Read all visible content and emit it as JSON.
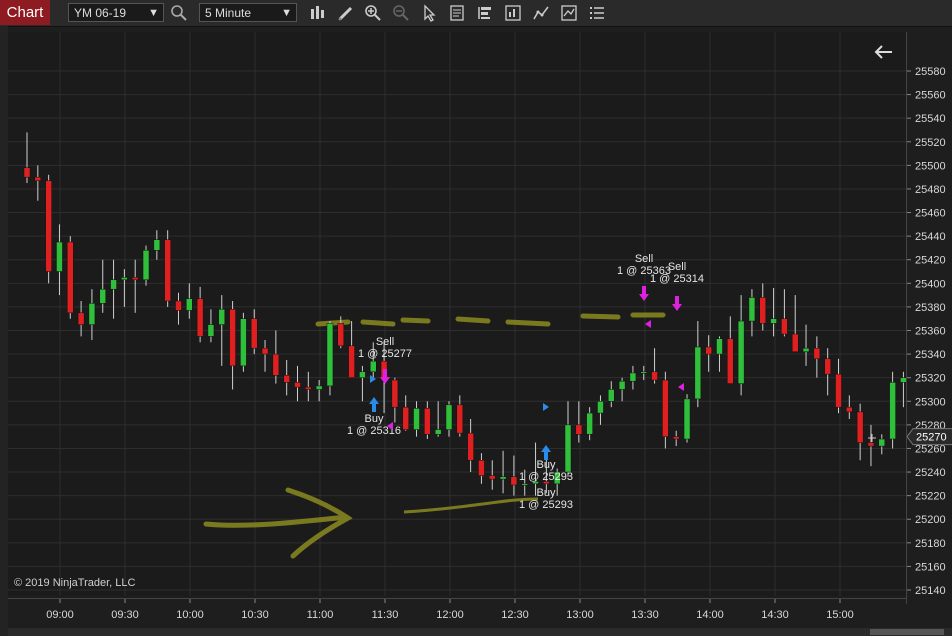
{
  "toolbar": {
    "tab_label": "Chart",
    "instrument": "YM 06-19",
    "interval": "5 Minute",
    "icons": [
      "search-icon",
      "bar-type-icon",
      "pencil-icon",
      "zoom-in-icon",
      "zoom-out-icon",
      "pointer-icon",
      "properties-icon",
      "strategies-icon",
      "indicators-icon",
      "drawing-tools-icon",
      "data-box-icon",
      "list-icon"
    ]
  },
  "copyright": "© 2019 NinjaTrader, LLC",
  "f_button": "F",
  "colors": {
    "up": "#2fbf3a",
    "down": "#e02020",
    "grid": "#2e2e2e",
    "buy": "#2b8be8",
    "sell": "#e020e0",
    "price_tag": "#2a2a2a",
    "highlighter": "#8b8a20"
  },
  "chart_data": {
    "type": "candlestick",
    "instrument": "YM 06-19",
    "interval": "5 Minute",
    "ylim": [
      25140,
      25600
    ],
    "y_ticks": [
      25580,
      25560,
      25540,
      25520,
      25500,
      25480,
      25460,
      25440,
      25420,
      25400,
      25380,
      25360,
      25340,
      25320,
      25300,
      25280,
      25260,
      25240,
      25220,
      25200,
      25180,
      25160,
      25140
    ],
    "x_ticks": [
      "09:00",
      "09:30",
      "10:00",
      "10:30",
      "11:00",
      "11:30",
      "12:00",
      "12:30",
      "13:00",
      "13:30",
      "14:00",
      "14:30",
      "15:00"
    ],
    "last_price": "25270",
    "candles": [
      [
        25498,
        25528,
        25485,
        25490
      ],
      [
        25490,
        25500,
        25470,
        25487
      ],
      [
        25487,
        25492,
        25400,
        25410
      ],
      [
        25410,
        25450,
        25390,
        25435
      ],
      [
        25435,
        25440,
        25370,
        25375
      ],
      [
        25375,
        25385,
        25355,
        25365
      ],
      [
        25365,
        25395,
        25352,
        25383
      ],
      [
        25383,
        25420,
        25375,
        25395
      ],
      [
        25395,
        25420,
        25370,
        25403
      ],
      [
        25403,
        25412,
        25380,
        25405
      ],
      [
        25405,
        25420,
        25375,
        25403
      ],
      [
        25403,
        25432,
        25398,
        25428
      ],
      [
        25428,
        25445,
        25420,
        25437
      ],
      [
        25437,
        25445,
        25380,
        25385
      ],
      [
        25385,
        25392,
        25365,
        25377
      ],
      [
        25377,
        25400,
        25370,
        25387
      ],
      [
        25387,
        25397,
        25350,
        25355
      ],
      [
        25355,
        25378,
        25350,
        25365
      ],
      [
        25365,
        25390,
        25330,
        25378
      ],
      [
        25378,
        25385,
        25310,
        25330
      ],
      [
        25330,
        25375,
        25325,
        25370
      ],
      [
        25370,
        25378,
        25340,
        25345
      ],
      [
        25345,
        25352,
        25325,
        25340
      ],
      [
        25340,
        25360,
        25315,
        25322
      ],
      [
        25322,
        25335,
        25305,
        25316
      ],
      [
        25316,
        25330,
        25300,
        25312
      ],
      [
        25312,
        25325,
        25300,
        25310
      ],
      [
        25310,
        25318,
        25300,
        25313
      ],
      [
        25313,
        25368,
        25305,
        25366
      ],
      [
        25366,
        25372,
        25345,
        25347
      ],
      [
        25347,
        25368,
        25340,
        25320
      ],
      [
        25320,
        25330,
        25300,
        25325
      ],
      [
        25325,
        25350,
        25320,
        25334
      ],
      [
        25334,
        25350,
        25290,
        25318
      ],
      [
        25318,
        25320,
        25282,
        25295
      ],
      [
        25295,
        25305,
        25275,
        25276
      ],
      [
        25276,
        25300,
        25270,
        25294
      ],
      [
        25294,
        25300,
        25268,
        25272
      ],
      [
        25272,
        25300,
        25270,
        25276
      ],
      [
        25276,
        25300,
        25270,
        25297
      ],
      [
        25297,
        25305,
        25270,
        25273
      ],
      [
        25273,
        25285,
        25240,
        25250
      ],
      [
        25250,
        25256,
        25230,
        25237
      ],
      [
        25237,
        25250,
        25225,
        25234
      ],
      [
        25234,
        25258,
        25222,
        25236
      ],
      [
        25236,
        25254,
        25220,
        25229
      ],
      [
        25229,
        25242,
        25220,
        25230
      ],
      [
        25230,
        25265,
        25220,
        25232
      ],
      [
        25232,
        25252,
        25222,
        25230
      ],
      [
        25230,
        25243,
        25220,
        25240
      ],
      [
        25240,
        25300,
        25236,
        25280
      ],
      [
        25280,
        25300,
        25265,
        25272
      ],
      [
        25272,
        25295,
        25267,
        25290
      ],
      [
        25290,
        25305,
        25280,
        25300
      ],
      [
        25300,
        25317,
        25295,
        25310
      ],
      [
        25310,
        25320,
        25300,
        25317
      ],
      [
        25317,
        25330,
        25310,
        25324
      ],
      [
        25324,
        25330,
        25318,
        25325
      ],
      [
        25325,
        25345,
        25315,
        25318
      ],
      [
        25318,
        25325,
        25260,
        25270
      ],
      [
        25270,
        25275,
        25262,
        25268
      ],
      [
        25268,
        25306,
        25265,
        25302
      ],
      [
        25302,
        25368,
        25295,
        25346
      ],
      [
        25346,
        25356,
        25325,
        25340
      ],
      [
        25340,
        25355,
        25325,
        25353
      ],
      [
        25353,
        25372,
        25320,
        25315
      ],
      [
        25315,
        25390,
        25305,
        25368
      ],
      [
        25368,
        25395,
        25355,
        25388
      ],
      [
        25388,
        25400,
        25360,
        25366
      ],
      [
        25366,
        25396,
        25355,
        25370
      ],
      [
        25370,
        25395,
        25355,
        25357
      ],
      [
        25357,
        25390,
        25345,
        25342
      ],
      [
        25342,
        25365,
        25330,
        25345
      ],
      [
        25345,
        25355,
        25320,
        25336
      ],
      [
        25336,
        25345,
        25305,
        25323
      ],
      [
        25323,
        25336,
        25290,
        25295
      ],
      [
        25295,
        25305,
        25285,
        25291
      ],
      [
        25291,
        25298,
        25250,
        25265
      ],
      [
        25265,
        25280,
        25245,
        25262
      ],
      [
        25262,
        25272,
        25255,
        25268
      ],
      [
        25268,
        25325,
        25260,
        25316
      ],
      [
        25316,
        25325,
        25295,
        25320
      ],
      [
        25320,
        25333,
        25300,
        25325
      ],
      [
        25325,
        25330,
        25290,
        25295
      ],
      [
        25295,
        25300,
        25268,
        25270
      ],
      [
        25270,
        25275,
        25266,
        25272
      ]
    ],
    "executions": [
      {
        "type": "Sell",
        "label": "Sell",
        "price_label": "1 @ 25277",
        "candle": 28
      },
      {
        "type": "Buy",
        "label": "Buy",
        "price_label": "1 @ 25316",
        "candle": 27
      },
      {
        "type": "Buy",
        "label": "Buy",
        "price_label": "1 @ 25293",
        "candle": 40
      },
      {
        "type": "Buy",
        "label": "Buy",
        "price_label": "1 @ 25293",
        "candle": 40
      },
      {
        "type": "Sell",
        "label": "Sell",
        "price_label": "1 @ 25363",
        "candle": 49
      },
      {
        "type": "Sell",
        "label": "Sell",
        "price_label": "1 @ 25314",
        "candle": 51
      }
    ]
  }
}
